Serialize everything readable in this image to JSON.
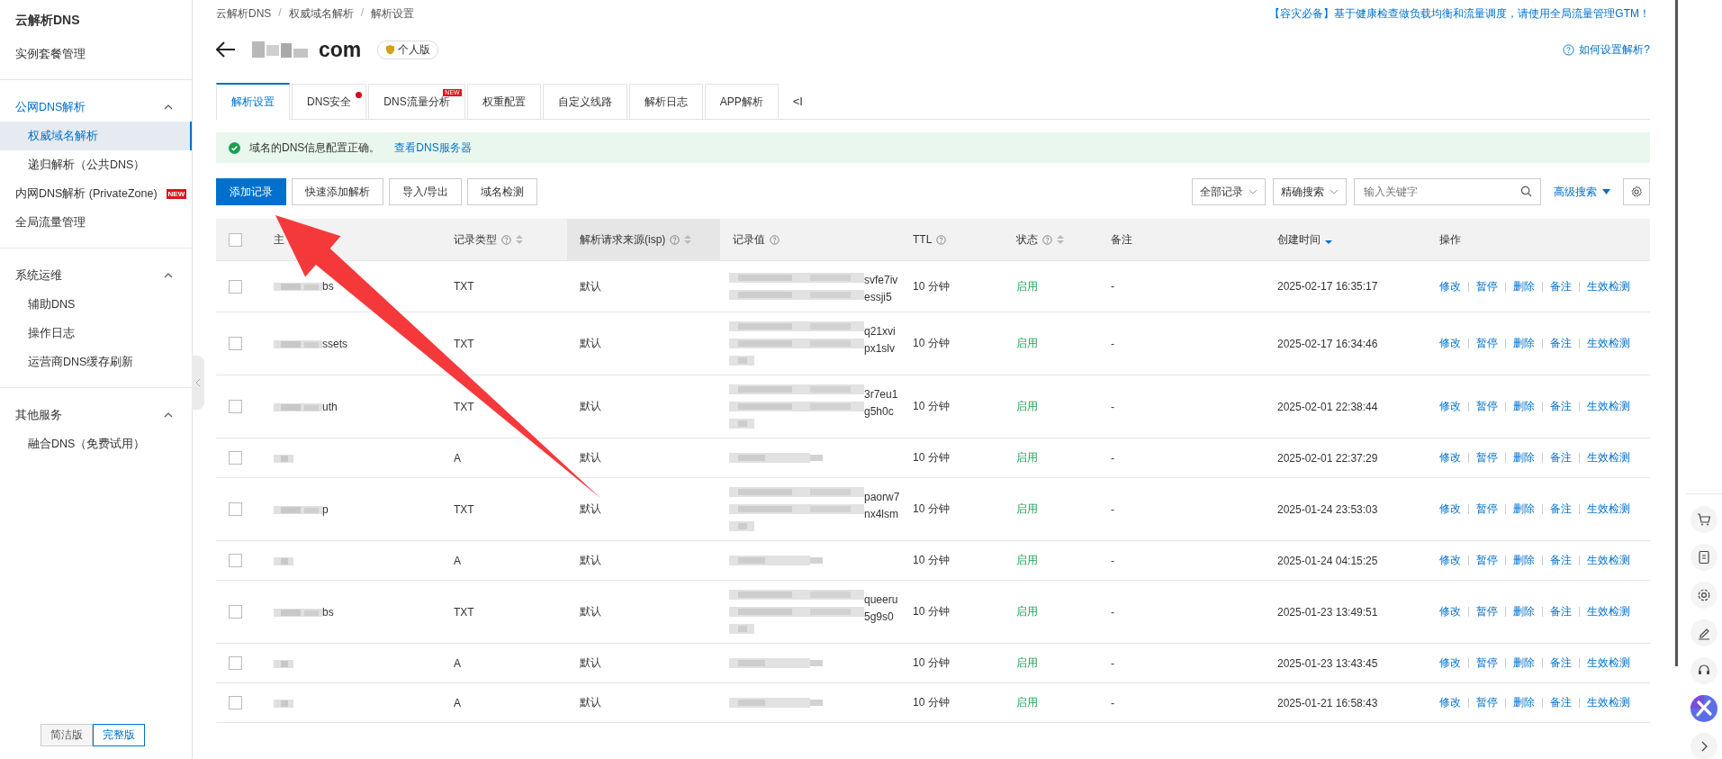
{
  "sidebar": {
    "title": "云解析DNS",
    "sections": [
      {
        "items": [
          {
            "label": "实例套餐管理",
            "selected": false
          }
        ]
      },
      {
        "group": "公网DNS解析",
        "expanded": true,
        "active": true,
        "children": [
          {
            "label": "权威域名解析",
            "selected": true
          },
          {
            "label": "递归解析（公共DNS）",
            "selected": false
          }
        ],
        "items": [
          {
            "label": "内网DNS解析 (PrivateZone)",
            "selected": false,
            "badge": "NEW"
          },
          {
            "label": "全局流量管理",
            "selected": false
          }
        ]
      },
      {
        "group": "系统运维",
        "expanded": true,
        "active": false,
        "children": [
          {
            "label": "辅助DNS",
            "selected": false
          },
          {
            "label": "操作日志",
            "selected": false
          },
          {
            "label": "运营商DNS缓存刷新",
            "selected": false
          }
        ]
      },
      {
        "group": "其他服务",
        "expanded": true,
        "active": false,
        "children": [
          {
            "label": "融合DNS（免费试用）",
            "selected": false
          }
        ]
      }
    ],
    "modes": [
      {
        "label": "简洁版",
        "selected": false
      },
      {
        "label": "完整版",
        "selected": true
      }
    ]
  },
  "breadcrumb": [
    {
      "label": "云解析DNS"
    },
    {
      "separator": "/",
      "label": "权威域名解析"
    },
    {
      "separator": "/",
      "label": "解析设置"
    }
  ],
  "notice": {
    "tag": "【容灾必备】",
    "text": "基于健康检查做负载均衡和流量调度，请使用全局流量管理GTM！"
  },
  "domain": {
    "visible_part": "com",
    "badge": "个人版"
  },
  "help_link": "如何设置解析?",
  "tabs": [
    {
      "label": "解析设置",
      "selected": true
    },
    {
      "label": "DNS安全",
      "selected": false,
      "dot": true
    },
    {
      "label": "DNS流量分析",
      "selected": false,
      "badge": "NEW"
    },
    {
      "label": "权重配置",
      "selected": false
    },
    {
      "label": "自定义线路",
      "selected": false
    },
    {
      "label": "解析日志",
      "selected": false
    },
    {
      "label": "APP解析",
      "selected": false
    }
  ],
  "tab_collapse": "<I",
  "alert": {
    "text": "域名的DNS信息配置正确。",
    "link": "查看DNS服务器"
  },
  "toolbar": {
    "buttons": [
      {
        "label": "添加记录",
        "primary": true
      },
      {
        "label": "快速添加解析",
        "primary": false
      },
      {
        "label": "导入/导出",
        "primary": false
      },
      {
        "label": "域名检测",
        "primary": false
      }
    ],
    "filter": "全部记录",
    "search_mode": "精确搜索",
    "search": {
      "placeholder": "输入关键字"
    },
    "advanced": "高级搜索"
  },
  "table": {
    "all_checked": false,
    "columns": [
      {
        "label": "主",
        "highlighted": false
      },
      {
        "label": "记录类型",
        "help": true,
        "sortable": true,
        "sort_desc": false,
        "highlighted": false
      },
      {
        "label": "解析请求来源(isp)",
        "help": true,
        "sortable": true,
        "sort_desc": false,
        "highlighted": true
      },
      {
        "label": "记录值",
        "help": true,
        "highlighted": false
      },
      {
        "label": "TTL",
        "help": true,
        "highlighted": false
      },
      {
        "label": "状态",
        "help": true,
        "sortable": true,
        "sort_desc": false,
        "highlighted": false
      },
      {
        "label": "备注",
        "highlighted": false
      },
      {
        "label": "创建时间",
        "sortable": true,
        "sort_desc": true,
        "highlighted": false
      },
      {
        "label": "操作",
        "highlighted": false
      }
    ],
    "rows": [
      {
        "checked": false,
        "host": "bs",
        "type": "TXT",
        "isp": "默认",
        "value": {
          "kind": "two-line",
          "lines": [
            "svfe7iv",
            "essji5"
          ]
        },
        "ttl": "10 分钟",
        "status": "启用",
        "enabled": true,
        "note": "-",
        "created": "2025-02-17 16:35:17",
        "actions": [
          "修改",
          "暂停",
          "删除",
          "备注",
          "生效检测"
        ]
      },
      {
        "checked": false,
        "host": "ssets",
        "type": "TXT",
        "isp": "默认",
        "value": {
          "kind": "three-line",
          "lines": [
            "q21xvi",
            "px1slv"
          ]
        },
        "ttl": "10 分钟",
        "status": "启用",
        "enabled": true,
        "note": "-",
        "created": "2025-02-17 16:34:46",
        "actions": [
          "修改",
          "暂停",
          "删除",
          "备注",
          "生效检测"
        ]
      },
      {
        "checked": false,
        "host": "uth",
        "type": "TXT",
        "isp": "默认",
        "value": {
          "kind": "three-line",
          "lines": [
            "3r7eu1",
            "g5h0c"
          ]
        },
        "ttl": "10 分钟",
        "status": "启用",
        "enabled": true,
        "note": "-",
        "created": "2025-02-01 22:38:44",
        "actions": [
          "修改",
          "暂停",
          "删除",
          "备注",
          "生效检测"
        ]
      },
      {
        "checked": false,
        "type": "A",
        "isp": "默认",
        "value": {
          "kind": "one-line"
        },
        "ttl": "10 分钟",
        "status": "启用",
        "enabled": true,
        "note": "-",
        "created": "2025-02-01 22:37:29",
        "actions": [
          "修改",
          "暂停",
          "删除",
          "备注",
          "生效检测"
        ]
      },
      {
        "checked": false,
        "host": "p",
        "type": "TXT",
        "isp": "默认",
        "value": {
          "kind": "three-line",
          "lines": [
            "paorw7",
            "nx4lsm"
          ]
        },
        "ttl": "10 分钟",
        "status": "启用",
        "enabled": true,
        "note": "-",
        "created": "2025-01-24 23:53:03",
        "actions": [
          "修改",
          "暂停",
          "删除",
          "备注",
          "生效检测"
        ]
      },
      {
        "checked": false,
        "type": "A",
        "isp": "默认",
        "value": {
          "kind": "one-line"
        },
        "ttl": "10 分钟",
        "status": "启用",
        "enabled": true,
        "note": "-",
        "created": "2025-01-24 04:15:25",
        "actions": [
          "修改",
          "暂停",
          "删除",
          "备注",
          "生效检测"
        ]
      },
      {
        "checked": false,
        "host": "bs",
        "type": "TXT",
        "isp": "默认",
        "value": {
          "kind": "three-line",
          "lines": [
            "queeru",
            "5g9s0"
          ]
        },
        "ttl": "10 分钟",
        "status": "启用",
        "enabled": true,
        "note": "-",
        "created": "2025-01-23 13:49:51",
        "actions": [
          "修改",
          "暂停",
          "删除",
          "备注",
          "生效检测"
        ]
      },
      {
        "checked": false,
        "type": "A",
        "isp": "默认",
        "value": {
          "kind": "one-line"
        },
        "ttl": "10 分钟",
        "status": "启用",
        "enabled": true,
        "note": "-",
        "created": "2025-01-23 13:43:45",
        "actions": [
          "修改",
          "暂停",
          "删除",
          "备注",
          "生效检测"
        ]
      },
      {
        "checked": false,
        "type": "A",
        "isp": "默认",
        "value": {
          "kind": "one-line"
        },
        "ttl": "10 分钟",
        "status": "启用",
        "enabled": true,
        "note": "-",
        "created": "2025-01-21 16:58:43",
        "actions": [
          "修改",
          "暂停",
          "删除",
          "备注",
          "生效检测"
        ]
      }
    ]
  }
}
